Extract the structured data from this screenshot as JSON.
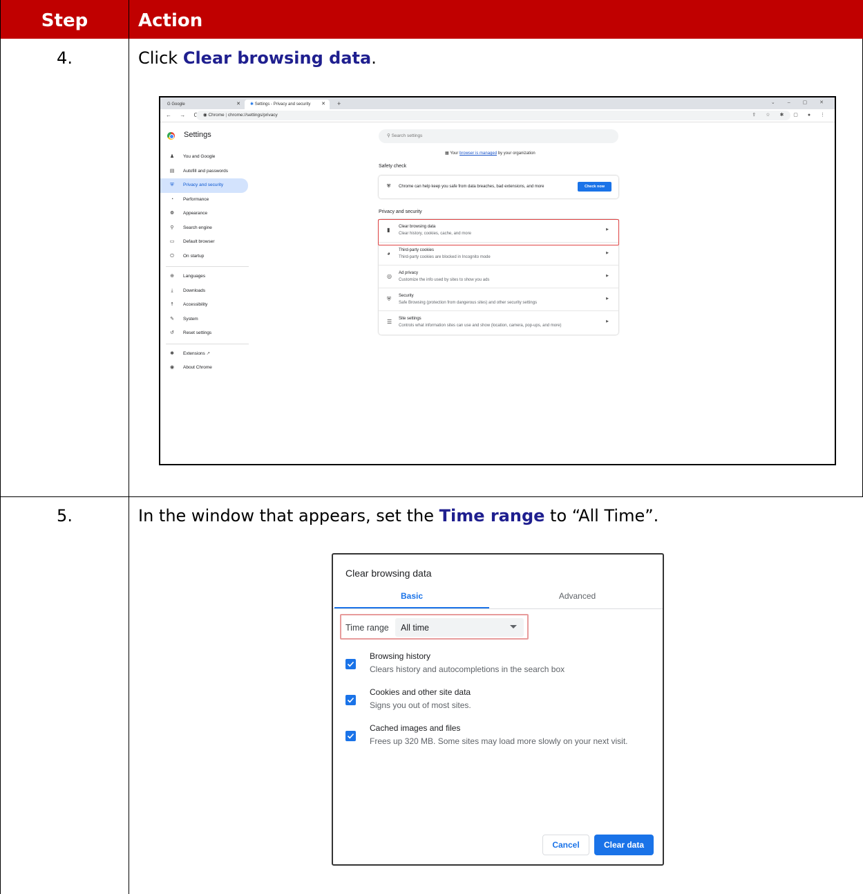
{
  "header": {
    "step": "Step",
    "action": "Action"
  },
  "steps": [
    {
      "number": "4.",
      "text_before": "Click ",
      "highlight": "Clear browsing data",
      "text_after": "."
    },
    {
      "number": "5.",
      "text_before": "In the window that appears, set the ",
      "highlight": "Time range",
      "text_after": " to “All Time”."
    }
  ],
  "chrome": {
    "tabs": [
      {
        "label": "G  Google"
      },
      {
        "label": "Settings - Privacy and security"
      }
    ],
    "new_tab": "+",
    "url_prefix": "Chrome",
    "url": "chrome://settings/privacy",
    "settings_title": "Settings",
    "search_placeholder": "Search settings",
    "managed_before": "Your ",
    "managed_link": "browser is managed",
    "managed_after": " by your organization",
    "nav_items": [
      {
        "label": "You and Google",
        "icon": "person-icon"
      },
      {
        "label": "Autofill and passwords",
        "icon": "clipboard-icon"
      },
      {
        "label": "Privacy and security",
        "icon": "shield-icon"
      },
      {
        "label": "Performance",
        "icon": "speedometer-icon"
      },
      {
        "label": "Appearance",
        "icon": "palette-icon"
      },
      {
        "label": "Search engine",
        "icon": "search-icon"
      },
      {
        "label": "Default browser",
        "icon": "browser-icon"
      },
      {
        "label": "On startup",
        "icon": "power-icon"
      },
      {
        "label": "Languages",
        "icon": "globe-icon"
      },
      {
        "label": "Downloads",
        "icon": "download-icon"
      },
      {
        "label": "Accessibility",
        "icon": "accessibility-icon"
      },
      {
        "label": "System",
        "icon": "wrench-icon"
      },
      {
        "label": "Reset settings",
        "icon": "reset-icon"
      },
      {
        "label": "Extensions",
        "icon": "puzzle-icon"
      },
      {
        "label": "About Chrome",
        "icon": "chrome-icon"
      }
    ],
    "safety_check_heading": "Safety check",
    "safety_check_text": "Chrome can help keep you safe from data breaches, bad extensions, and more",
    "check_now": "Check now",
    "privacy_heading": "Privacy and security",
    "privacy_rows": [
      {
        "title": "Clear browsing data",
        "desc": "Clear history, cookies, cache, and more",
        "icon": "trash-icon"
      },
      {
        "title": "Third-party cookies",
        "desc": "Third-party cookies are blocked in Incognito mode",
        "icon": "cookie-icon"
      },
      {
        "title": "Ad privacy",
        "desc": "Customize the info used by sites to show you ads",
        "icon": "ad-privacy-icon"
      },
      {
        "title": "Security",
        "desc": "Safe Browsing (protection from dangerous sites) and other security settings",
        "icon": "shield-icon"
      },
      {
        "title": "Site settings",
        "desc": "Controls what information sites can use and show (location, camera, pop-ups, and more)",
        "icon": "sliders-icon"
      }
    ]
  },
  "dialog": {
    "title": "Clear browsing data",
    "tab_basic": "Basic",
    "tab_advanced": "Advanced",
    "time_range_label": "Time range",
    "time_range_value": "All time",
    "options": [
      {
        "title": "Browsing history",
        "desc": "Clears history and autocompletions in the search box",
        "checked": true
      },
      {
        "title": "Cookies and other site data",
        "desc": "Signs you out of most sites.",
        "checked": true
      },
      {
        "title": "Cached images and files",
        "desc": "Frees up 320 MB. Some sites may load more slowly on your next visit.",
        "checked": true
      }
    ],
    "cancel": "Cancel",
    "clear": "Clear data"
  },
  "colors": {
    "header_bg": "#c00000",
    "highlight_text": "#1f1f8f",
    "accent": "#1a73e8",
    "callout": "#e04444"
  }
}
